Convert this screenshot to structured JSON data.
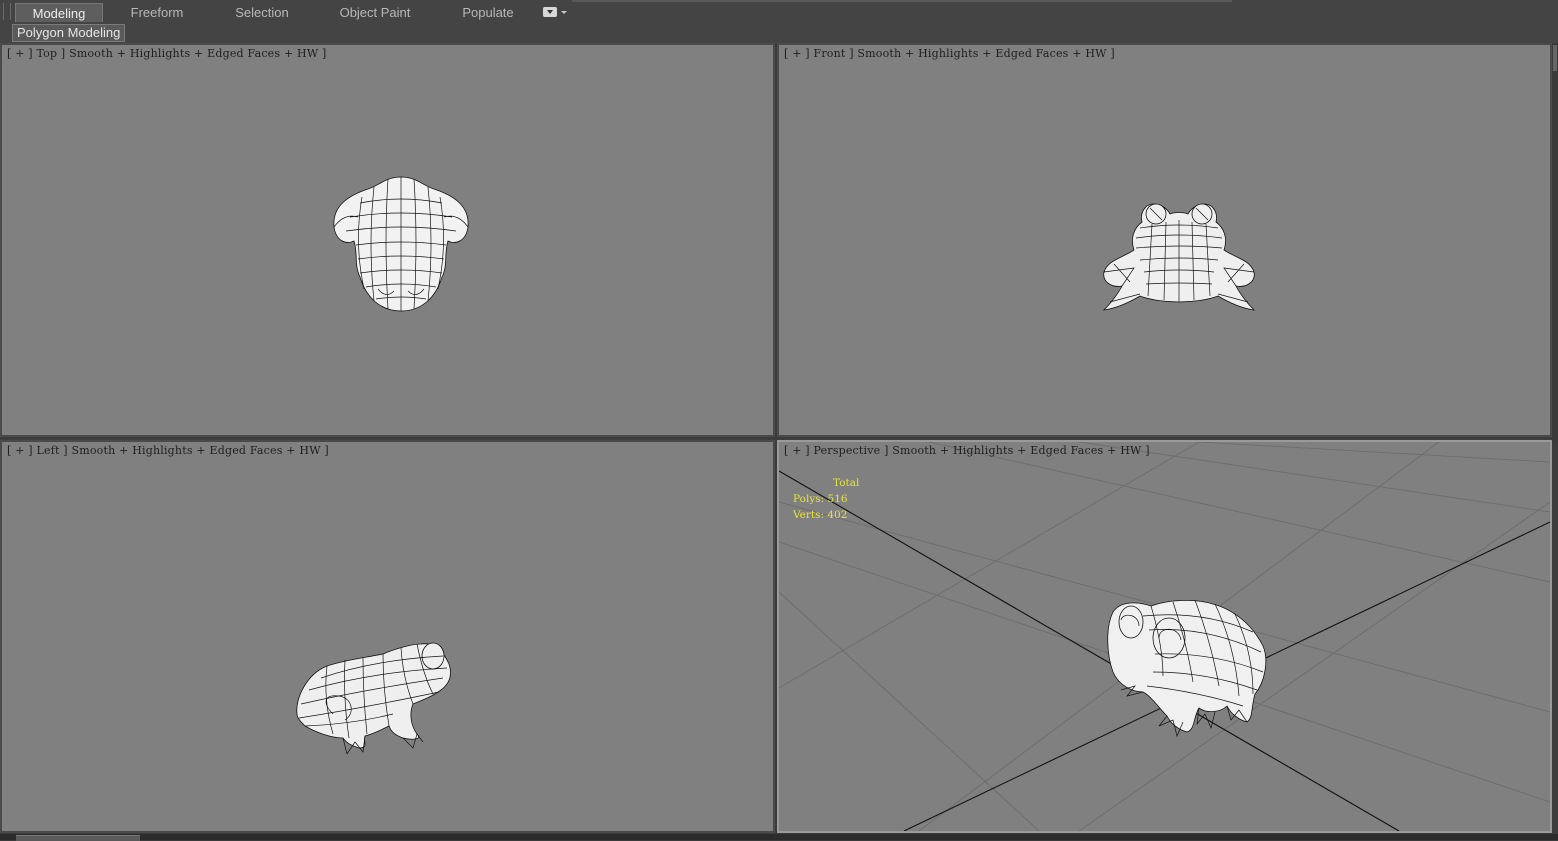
{
  "ribbon": {
    "tabs": [
      {
        "label": "Modeling",
        "active": true
      },
      {
        "label": "Freeform",
        "active": false
      },
      {
        "label": "Selection",
        "active": false
      },
      {
        "label": "Object Paint",
        "active": false
      },
      {
        "label": "Populate",
        "active": false
      }
    ],
    "panel_label": "Polygon Modeling"
  },
  "viewports": {
    "top": {
      "label": "[ + ] Top ] Smooth + Highlights + Edged Faces + HW ]"
    },
    "front": {
      "label": "[ + ] Front ] Smooth + Highlights + Edged Faces + HW ]"
    },
    "left": {
      "label": "[ + ] Left ] Smooth + Highlights + Edged Faces + HW ]"
    },
    "perspective": {
      "label": "[ + ] Perspective ] Smooth + Highlights + Edged Faces + HW ]"
    }
  },
  "stats": {
    "header": "Total",
    "polys_label": "Polys:",
    "polys_value": "516",
    "verts_label": "Verts:",
    "verts_value": "402"
  },
  "colors": {
    "viewport_bg": "#808080",
    "stats_text": "#e8e23a",
    "ui_dark": "#444444"
  }
}
